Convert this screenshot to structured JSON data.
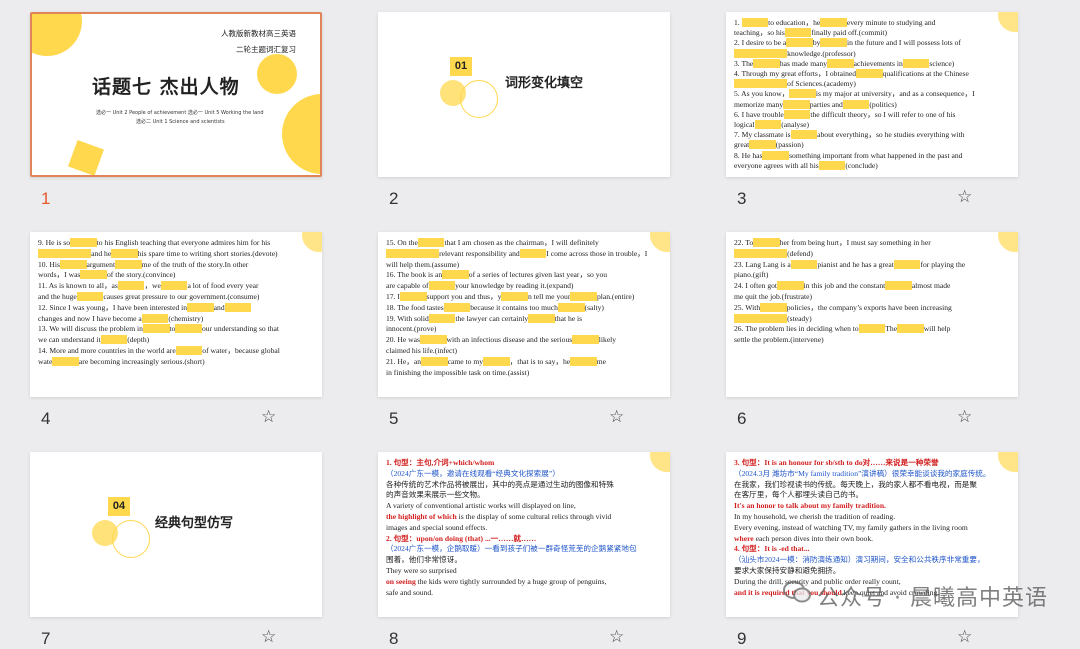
{
  "slides": [
    {
      "num": "1",
      "title": "话题七 杰出人物",
      "line1": "人教版新教材高三英语",
      "line2": "二轮主题词汇复习",
      "sub1": "选必一 Unit 2 People of achievement  选必一 Unit 5 Working the land",
      "sub2": "选必二 Unit 1 Science and scientists"
    },
    {
      "num": "2",
      "section": "01",
      "heading": "词形变化填空"
    },
    {
      "num": "3",
      "lines": [
        [
          "1.  ",
          "",
          "to education，he",
          "",
          "every minute to studying and"
        ],
        [
          "teaching，so his",
          "",
          "finally paid off.(commit)"
        ],
        [
          "2.  I desire to be a",
          "",
          "by",
          "",
          "in the future and I will possess lots of"
        ],
        [
          "",
          "",
          "knowledge.(professor)"
        ],
        [
          "3.  The",
          "",
          "has made many",
          "",
          "achievements in",
          "",
          "science)"
        ],
        [
          "4.  Through my great efforts，I obtained",
          "",
          "qualifications at the Chinese"
        ],
        [
          "",
          "",
          "of Sciences.(academy)"
        ],
        [
          "5.  As you know，",
          "",
          "is my major at university，and as a consequence，I"
        ],
        [
          "memorize many",
          "",
          "parties and",
          "",
          "(politics)"
        ],
        [
          "6.  I have trouble",
          "",
          "the difficult theory，so I will refer to one of his"
        ],
        [
          "logical",
          "",
          "(analyse)"
        ],
        [
          "7.  My classmate is",
          "",
          "about everything，so he studies everything with"
        ],
        [
          "great",
          "",
          "(passion)"
        ],
        [
          "8.  He has",
          "",
          "something important from what happened in the past and"
        ],
        [
          "everyone agrees with all his",
          "",
          "(conclude)"
        ]
      ]
    },
    {
      "num": "4",
      "lines": [
        [
          "9.  He is so",
          "",
          "to his English teaching that everyone admires him for his"
        ],
        [
          "",
          "",
          "and he",
          "",
          "his spare time to writing short stories.(devote)"
        ],
        [
          "10.  His",
          "",
          "argument",
          "",
          "me of the truth of the story.In other"
        ],
        [
          "words，I was",
          "",
          "of the story.(convince)"
        ],
        [
          "11.  As is known to all，as",
          "",
          "，we",
          "",
          "a lot of food every year"
        ],
        [
          "and the huge",
          "",
          "causes great pressure to our government.(consume)"
        ],
        [
          "12.  Since I was young，I have been interested in",
          "",
          "and",
          ""
        ],
        [
          "changes and now I have become a",
          "",
          "(chemistry)"
        ],
        [
          "13.  We will discuss the problem in",
          "",
          "to",
          "",
          "our understanding so that"
        ],
        [
          "we can understand it",
          "",
          "(depth)"
        ],
        [
          "14.  More and more countries in the world are",
          "",
          "of water，because global"
        ],
        [
          "wate",
          "",
          "are becoming increasingly serious.(short)"
        ]
      ]
    },
    {
      "num": "5",
      "lines": [
        [
          "15.  On the",
          "",
          "that I am chosen as the chairman，I will definitely"
        ],
        [
          "",
          "",
          "relevant responsibility and",
          "",
          "I come across those in trouble，I"
        ],
        [
          "will help them.(assume)"
        ],
        [
          "16.  The book is an",
          "",
          "of a series of lectures given last year，so you"
        ],
        [
          "are capable of",
          "",
          "your knowledge by reading it.(expand)"
        ],
        [
          "17.  I",
          "",
          "support you and thus，y",
          "",
          "n tell me your",
          "",
          "plan.(entire)"
        ],
        [
          "18.  The food tastes",
          "",
          "because it contains too much",
          "",
          "(salty)"
        ],
        [
          "19.  With solid",
          "",
          "the lawyer can certainly",
          "",
          "that he is"
        ],
        [
          "innocent.(prove)"
        ],
        [
          "20.  He was",
          "",
          "with an infectious disease and the serious",
          "",
          "likely"
        ],
        [
          "claimed his life.(infect)"
        ],
        [
          "21.  He，an",
          "",
          "came to my",
          "",
          "，that is to say，he",
          "",
          "me"
        ],
        [
          "in finishing the impossible task on time.(assist)"
        ]
      ]
    },
    {
      "num": "6",
      "lines": [
        [
          "22.  To",
          "",
          "her from being hurt，I must say something in her"
        ],
        [
          "",
          "",
          "(defend)"
        ],
        [
          "23.  Lang Lang is a",
          "",
          "pianist and he has a great",
          "",
          "for playing the"
        ],
        [
          "piano.(gift)"
        ],
        [
          "24.  I often got",
          "",
          "in this job and the constant",
          "",
          "almost made"
        ],
        [
          "me quit the job.(frustrate)"
        ],
        [
          "25.  With",
          "",
          "policies，the company’s exports have been increasing"
        ],
        [
          "",
          "",
          "(steady)"
        ],
        [
          "26.  The problem lies in deciding when to",
          "",
          "The",
          "",
          "will help"
        ],
        [
          "settle the problem.(intervene)"
        ]
      ]
    },
    {
      "num": "7",
      "section": "04",
      "heading": "经典句型仿写"
    },
    {
      "num": "8",
      "lines": [
        {
          "c": "red",
          "t": "1. 句型：主句,介词+which/whom"
        },
        {
          "c": "blue",
          "t": "（2024广东一模，邀请在线观看“经典文化探索展”）"
        },
        {
          "c": "",
          "t": "各种传统的艺术作品将被展出，其中的亮点是通过生动的图像和特殊"
        },
        {
          "c": "",
          "t": "的声音效果来展示一些文物。"
        },
        {
          "c": "",
          "t": "A variety of conventional artistic works will displayed on line,"
        },
        {
          "c": "mix",
          "r": "the highlight of which",
          "t": " is the display of some cultural relics through vivid"
        },
        {
          "c": "",
          "t": "images and special sound effects."
        },
        {
          "c": "red",
          "t": "2. 句型：upon/on doing (that) ...一……就……"
        },
        {
          "c": "blue",
          "t": "（2024广东一模，企鹅取暖）一看到孩子们被一群奇怪荒芜的企鹅紧紧地包"
        },
        {
          "c": "",
          "t": "围着，他们非常惊讶。"
        },
        {
          "c": "",
          "t": "They were so surprised"
        },
        {
          "c": "mix",
          "r": "on seeing",
          "t": " the kids were tightly surrounded by a huge group of penguins,"
        },
        {
          "c": "",
          "t": "safe and sound."
        }
      ]
    },
    {
      "num": "9",
      "lines": [
        {
          "c": "red",
          "t": "3. 句型：It is an honour for sb/sth to do对……来说是一种荣誉"
        },
        {
          "c": "blue",
          "t": "（2024.3月 潍坊市“My family tradition”演讲稿）很荣幸能谈谈我的家庭传统。"
        },
        {
          "c": "",
          "t": "在我家，我们珍视读书的传统。每天晚上，我的家人都不看电视，而是聚"
        },
        {
          "c": "",
          "t": "在客厅里，每个人都埋头读自己的书。"
        },
        {
          "c": "red",
          "t": "It's an honor to talk about my family tradition."
        },
        {
          "c": "",
          "t": "In my household, we cherish the tradition of reading."
        },
        {
          "c": "",
          "t": "Every evening, instead of watching TV, my family gathers in the living room"
        },
        {
          "c": "mix",
          "r": "where",
          "t": " each person dives into their own book."
        },
        {
          "c": "red",
          "t": "4. 句型：It is -ed that..."
        },
        {
          "c": "blue",
          "t": "（汕头市2024一模：消防演练通知）演习期间，安全和公共秩序非常重要，"
        },
        {
          "c": "",
          "t": "要求大家保持安静和避免拥挤。"
        },
        {
          "c": "",
          "t": "During the drill, security and public order really count,"
        },
        {
          "c": "mix",
          "r": "and it is required that you should",
          "t": " keep quiet and avoid crowding."
        }
      ]
    }
  ],
  "watermark": "公众号 · 晨曦高中英语",
  "colors": {
    "accent": "#ffd84d",
    "selected_border": "#e0845a",
    "active_number": "#e65a2e"
  }
}
